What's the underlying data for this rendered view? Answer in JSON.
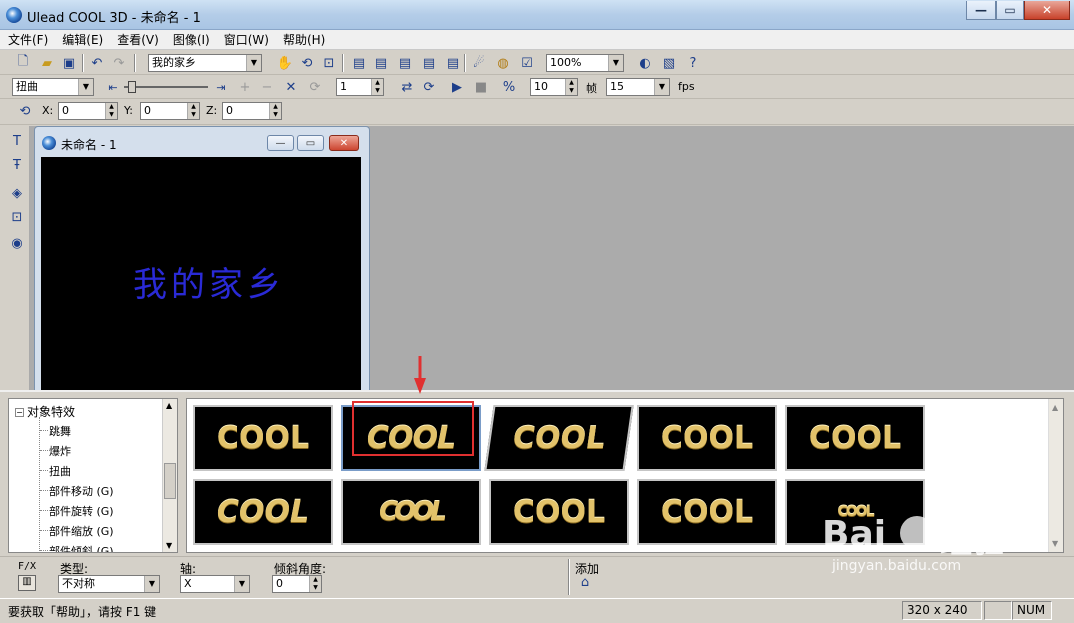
{
  "window": {
    "title": "Ulead COOL 3D - 未命名 - 1",
    "minimize": "—",
    "maximize": "▭",
    "close": "✕"
  },
  "menu": [
    "文件(F)",
    "编辑(E)",
    "查看(V)",
    "图像(I)",
    "窗口(W)",
    "帮助(H)"
  ],
  "toolbar1": {
    "text_object": "我的家乡",
    "zoom": "100%"
  },
  "toolbar2": {
    "effect": "扭曲",
    "frame": "1",
    "fps_value": "10",
    "frame_label": "帧",
    "frame_count": "15",
    "fps_label": "fps"
  },
  "toolbar3": {
    "x_label": "X:",
    "x": "0",
    "y_label": "Y:",
    "y": "0",
    "z_label": "Z:",
    "z": "0"
  },
  "document": {
    "title": "未命名 - 1",
    "canvas_text": "我的家乡"
  },
  "tree": {
    "root": "对象特效",
    "root_toggle": "−",
    "items": [
      "跳舞",
      "爆炸",
      "扭曲",
      "部件移动 (G)",
      "部件旋转 (G)",
      "部件缩放 (G)",
      "部件倾斜 (G)"
    ]
  },
  "gallery": {
    "thumbs": [
      "COOL",
      "COOL",
      "COOL",
      "COOL",
      "COOL",
      "COOL",
      "COOL",
      "COOL",
      "COOL",
      "COOL"
    ]
  },
  "props": {
    "fx_label": "F/X",
    "type_label": "类型:",
    "type_value": "不对称",
    "axis_label": "轴:",
    "axis_value": "X",
    "angle_label": "倾斜角度:",
    "angle_value": "0",
    "add_label": "添加"
  },
  "status": {
    "help": "要获取「帮助」，请按 F1 键",
    "size": "320 x 240",
    "num": "NUM"
  },
  "watermark": {
    "brand": "Bai",
    "brand2": "经验",
    "url": "jingyan.baidu.com"
  },
  "colors": {
    "highlight": "#e03030",
    "canvas_text": "#2a2ad6",
    "gold": "#e2c26a"
  }
}
